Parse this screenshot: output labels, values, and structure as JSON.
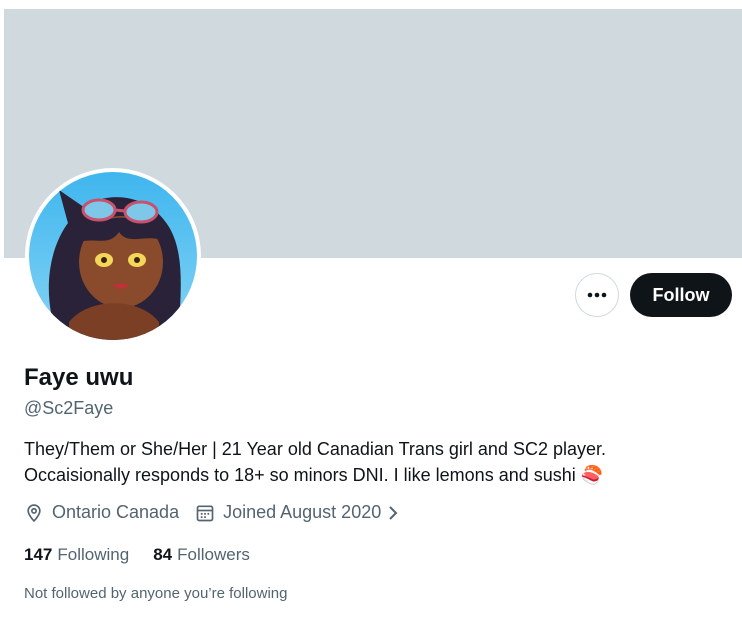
{
  "profile": {
    "display_name": "Faye uwu",
    "handle": "@Sc2Faye",
    "bio_line1": "They/Them or She/Her | 21 Year old Canadian Trans girl and SC2 player.",
    "bio_line2": "Occaisionally responds to 18+ so minors DNI.  I like lemons and sushi",
    "bio_emoji": "🍣",
    "location": "Ontario Canada",
    "joined": "Joined August 2020",
    "following_count": "147",
    "following_label": "Following",
    "followers_count": "84",
    "followers_label": "Followers",
    "mutual_note": "Not followed by anyone you’re following"
  },
  "actions": {
    "follow_label": "Follow",
    "more_label": "•••"
  },
  "colors": {
    "banner": "#cfd9de",
    "follow_bg": "#0f1419",
    "secondary_text": "#536471"
  },
  "icons": {
    "location": "location-pin-icon",
    "calendar": "calendar-icon",
    "chevron": "chevron-right-icon",
    "more": "more-dots-icon"
  }
}
